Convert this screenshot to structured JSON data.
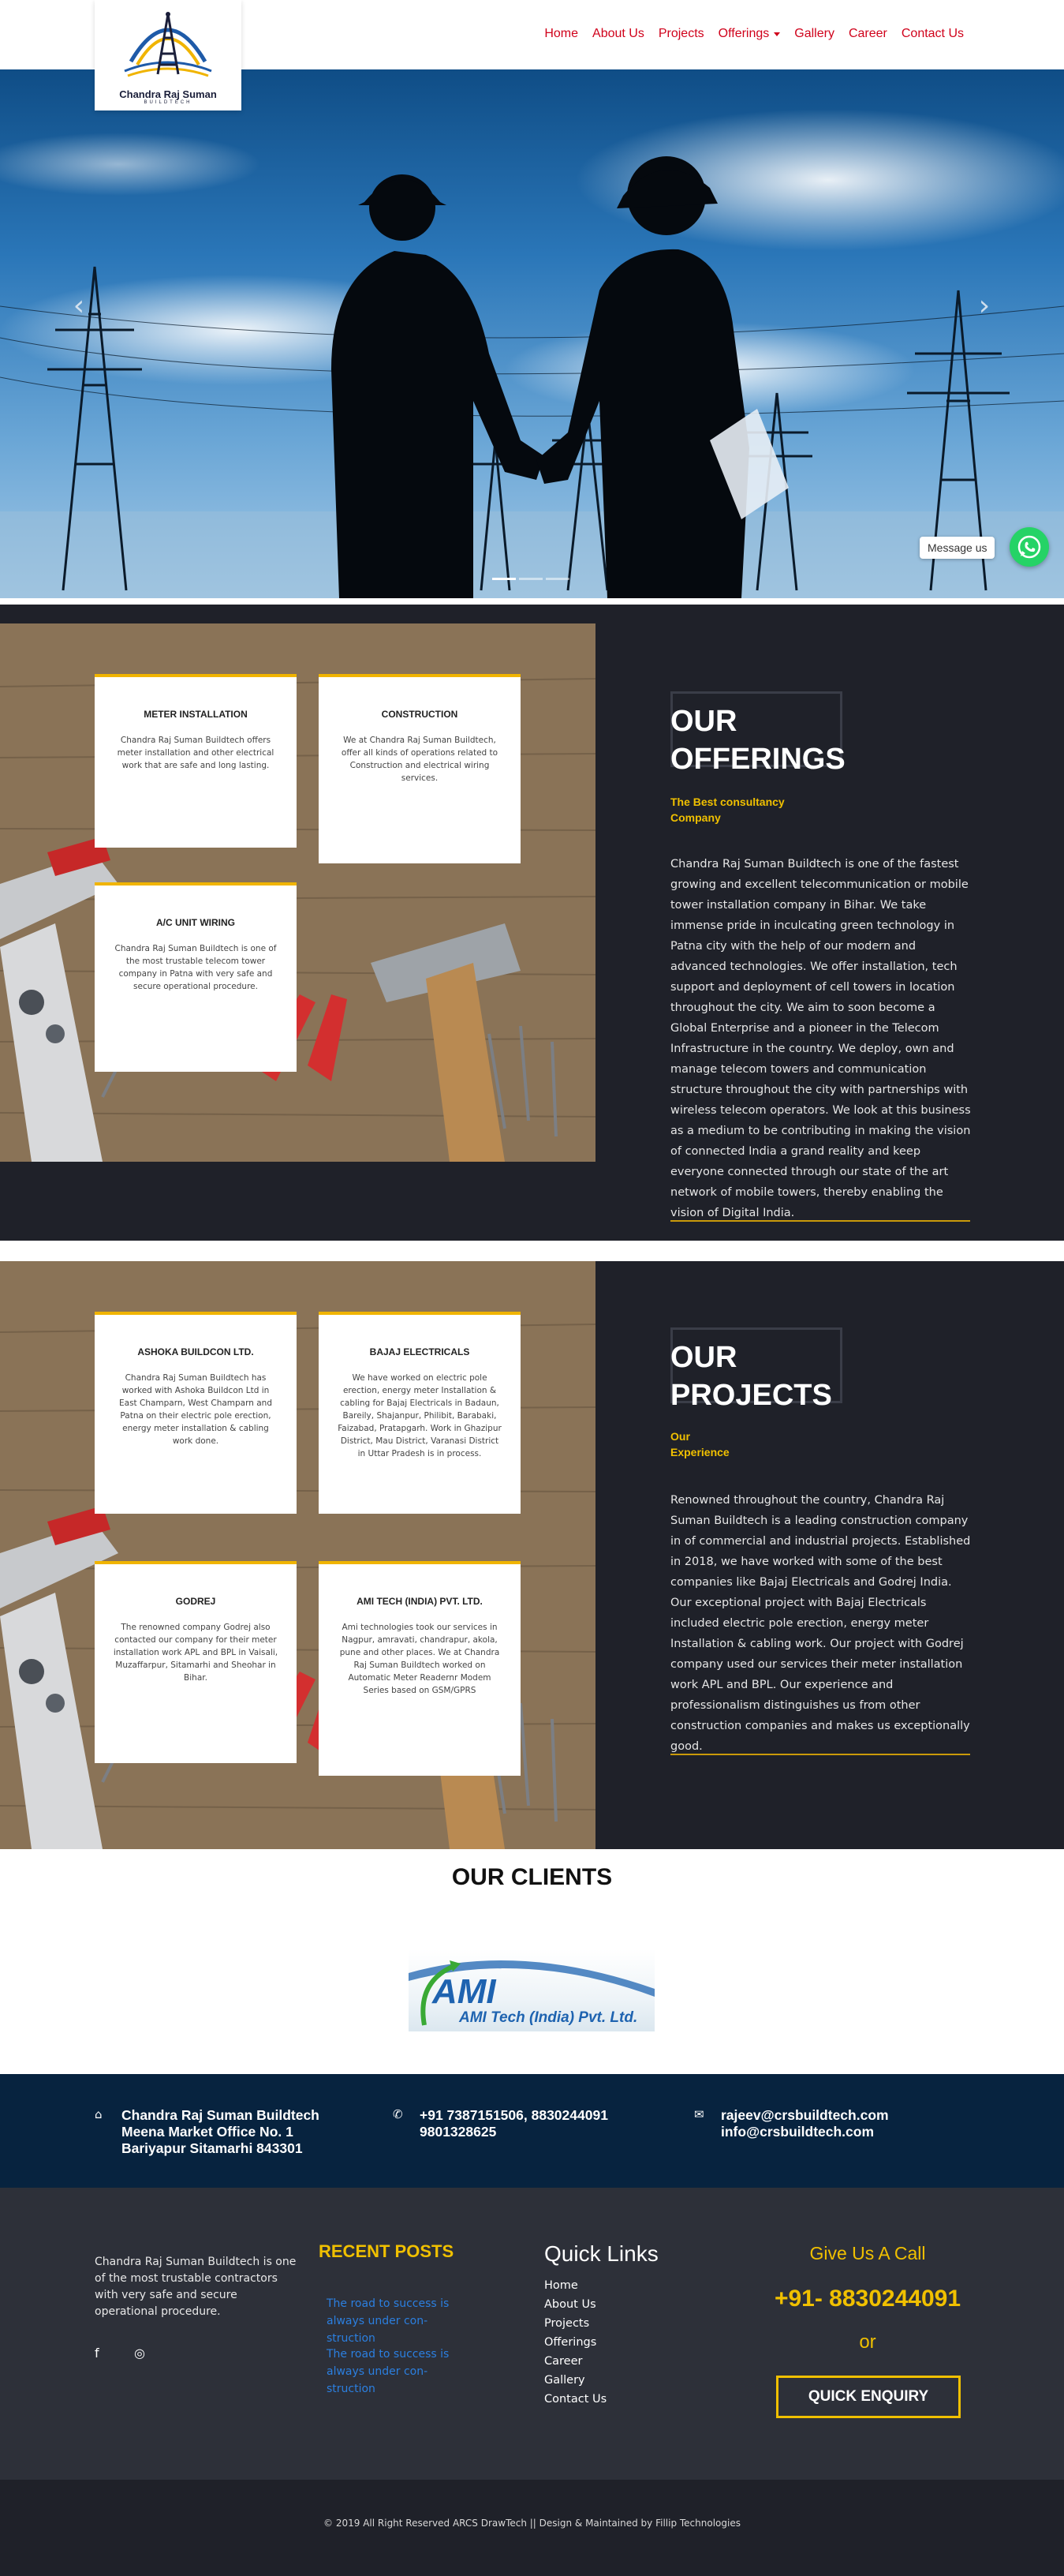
{
  "brand": {
    "name": "Chandra Raj Suman",
    "tagline": "BUILDTECH",
    "colors": {
      "nav": "#d0021b",
      "accent": "#f0c000",
      "dark": "#1f2129",
      "contact_bar": "#07233f"
    }
  },
  "nav": {
    "items": [
      {
        "label": "Home"
      },
      {
        "label": "About Us"
      },
      {
        "label": "Projects"
      },
      {
        "label": "Offerings",
        "dropdown": true
      },
      {
        "label": "Gallery"
      },
      {
        "label": "Career"
      },
      {
        "label": "Contact Us"
      }
    ]
  },
  "hero": {
    "prev_icon": "chevron-left-icon",
    "next_icon": "chevron-right-icon",
    "prev_glyph": "‹",
    "next_glyph": "›",
    "slides_total": 3,
    "active_slide": 1
  },
  "whatsapp": {
    "label": "Message us",
    "icon": "whatsapp-icon"
  },
  "offerings": {
    "title_line1": "OUR",
    "title_line2": "OFFERINGS",
    "subtitle": "The Best consultancy Company",
    "body": "Chandra Raj Suman Buildtech is one of the fastest growing and excellent telecommunication or mobile tower installation company in Bihar. We take immense pride in inculcating green technology in Patna city with the help of our modern and advanced technologies. We offer installation, tech support and deployment of cell towers in location throughout the city. We aim to soon become a Global Enterprise and a pioneer in the Telecom Infrastructure in the country. We deploy, own and manage telecom towers and communication structure throughout the city with partnerships with wireless telecom operators. We look at this business as a medium to be contributing in making the vision of connected India a grand reality and keep everyone connected through our state of the art network of mobile towers, thereby enabling the vision of Digital India.",
    "cards": [
      {
        "title": "METER INSTALLATION",
        "text": "Chandra Raj Suman Buildtech offers meter installation and other electrical work that are safe and long lasting."
      },
      {
        "title": "CONSTRUCTION",
        "text": "We at Chandra Raj Suman Buildtech, offer all kinds of operations related to Construction and electrical wiring services."
      },
      {
        "title": "A/C UNIT WIRING",
        "text": "Chandra Raj Suman Buildtech is one of the most trustable telecom tower company in Patna with very safe and secure operational procedure."
      }
    ]
  },
  "projects": {
    "title_line1": "OUR",
    "title_line2": "PROJECTS",
    "subtitle": "Our Experience",
    "body": "Renowned throughout the country, Chandra Raj Suman Buildtech is a leading construction company in of commercial and industrial projects. Established in 2018, we have worked with some of the best companies like Bajaj Electricals and Godrej India. Our exceptional project with Bajaj Electricals included electric pole erection, energy meter Installation & cabling work. Our project with Godrej company used our services their meter installation work APL and BPL. Our experience and professionalism distinguishes us from other construction companies and makes us exceptionally good.",
    "cards": [
      {
        "title": "ASHOKA BUILDCON LTD.",
        "text": "Chandra Raj Suman Buildtech has worked with Ashoka Buildcon Ltd in East Champarn, West Champarn and Patna on their electric pole erection, energy meter installation & cabling work done."
      },
      {
        "title": "BAJAJ ELECTRICALS",
        "text": "We have worked on electric pole erection, energy meter Installation & cabling for Bajaj Electricals in Badaun, Bareily, Shajanpur, Philibit, Barabaki, Faizabad, Pratapgarh. Work in Ghazipur District, Mau District, Varanasi District in Uttar Pradesh is in process."
      },
      {
        "title": "GODREJ",
        "text": "The renowned company Godrej also contacted our company for their meter installation work APL and BPL in Vaisali, Muzaffarpur, Sitamarhi and Sheohar in Bihar."
      },
      {
        "title": "AMI TECH (INDIA) PVT. LTD.",
        "text": "Ami technologies took our services in Nagpur, amravati, chandrapur, akola, pune and other places. We at Chandra Raj Suman Buildtech worked on Automatic Meter Readernr Modem Series based on GSM/GPRS"
      }
    ]
  },
  "clients": {
    "title": "OUR CLIENTS",
    "logos": [
      {
        "name": "AMI",
        "caption": "AMI Tech (India) Pvt. Ltd."
      }
    ]
  },
  "contact": {
    "address": {
      "icon": "home-icon",
      "glyph": "⌂",
      "lines": [
        "Chandra Raj Suman Buildtech",
        "Meena Market Office No. 1",
        "Bariyapur Sitamarhi 843301"
      ]
    },
    "phone": {
      "icon": "phone-icon",
      "glyph": "✆",
      "lines": [
        "+91 7387151506, 8830244091",
        "9801328625"
      ]
    },
    "email": {
      "icon": "envelope-icon",
      "glyph": "✉",
      "lines": [
        "rajeev@crsbuildtech.com",
        "info@crsbuildtech.com"
      ]
    }
  },
  "footer": {
    "about": "Chandra Raj Suman Buildtech is one of the most trustable contractors with very safe and secure operational procedure.",
    "social": [
      {
        "icon": "facebook-icon",
        "glyph": "f"
      },
      {
        "icon": "instagram-icon",
        "glyph": "◎"
      }
    ],
    "recent_posts_title": "RECENT POSTS",
    "recent_posts": [
      "The road to success is always under con-struction",
      "The road to success is always under con-struction"
    ],
    "quick_links_title": "Quick Links",
    "quick_links": [
      "Home",
      "About Us",
      "Projects",
      "Offerings",
      "Career",
      "Gallery",
      "Contact Us"
    ],
    "call_title": "Give Us A Call",
    "call_phone": "+91- 8830244091",
    "call_or": "or",
    "enquiry_button": "QUICK ENQUIRY"
  },
  "copyright": "© 2019 All Right Reserved ARCS DrawTech || Design & Maintained by Fillip Technologies"
}
